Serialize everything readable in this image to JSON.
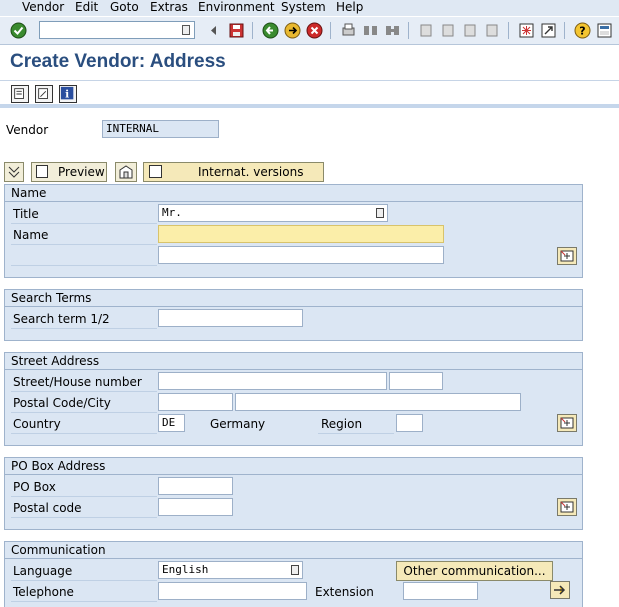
{
  "menu": [
    "Vendor",
    "Edit",
    "Goto",
    "Extras",
    "Environment",
    "System",
    "Help"
  ],
  "title": "Create Vendor: Address",
  "vendor": {
    "label": "Vendor",
    "value": "INTERNAL"
  },
  "buttons": {
    "preview": "Preview",
    "internat": "Internat. versions"
  },
  "name_section": {
    "title": "Name",
    "title_label": "Title",
    "title_value": "Mr.",
    "name_label": "Name"
  },
  "search_section": {
    "title": "Search Terms",
    "search_label": "Search term 1/2"
  },
  "street_section": {
    "title": "Street Address",
    "street_label": "Street/House number",
    "postal_label": "Postal Code/City",
    "country_label": "Country",
    "country_value": "DE",
    "country_name": "Germany",
    "region_label": "Region"
  },
  "pobox_section": {
    "title": "PO Box Address",
    "pobox_label": "PO Box",
    "postal_label": "Postal code"
  },
  "comm_section": {
    "title": "Communication",
    "language_label": "Language",
    "language_value": "English",
    "other_comm": "Other communication...",
    "telephone_label": "Telephone",
    "extension_label": "Extension"
  }
}
